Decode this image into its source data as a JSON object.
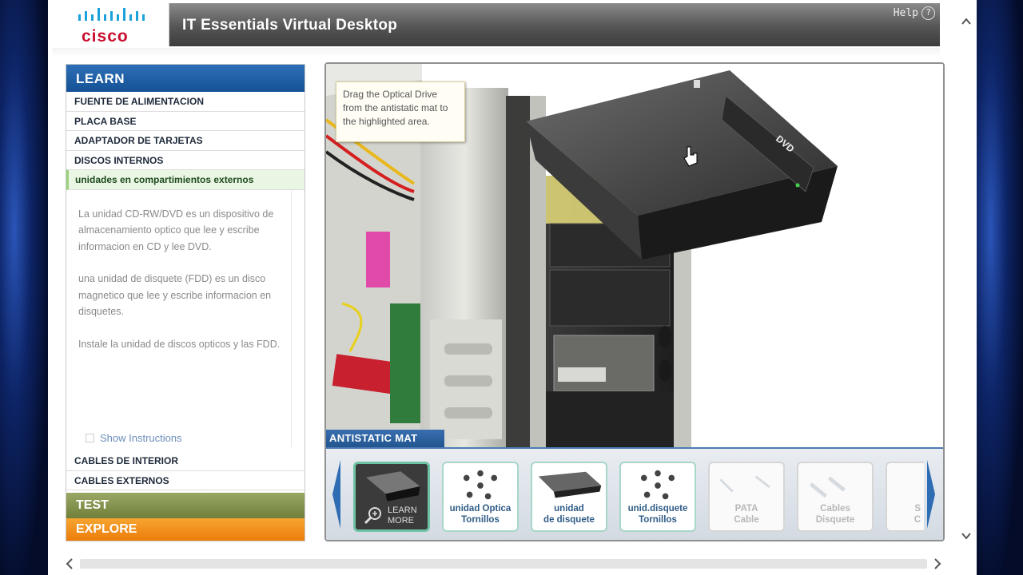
{
  "header": {
    "brand": "cisco",
    "title": "IT Essentials Virtual Desktop",
    "help_label": "Help",
    "help_icon_glyph": "?"
  },
  "learn": {
    "heading": "LEARN",
    "items": [
      {
        "label": "FUENTE DE ALIMENTACION"
      },
      {
        "label": "PLACA BASE"
      },
      {
        "label": "ADAPTADOR DE TARJETAS"
      },
      {
        "label": "DISCOS INTERNOS"
      },
      {
        "label": "unidades en compartimientos externos",
        "active": true
      }
    ],
    "description": [
      "La unidad CD-RW/DVD es un dispositivo de almacenamiento optico que lee y escribe informacion en CD y lee DVD.",
      "una unidad de disquete (FDD) es un disco magnetico que lee y escribe informacion en disquetes.",
      "Instale la unidad de discos opticos y las FDD."
    ],
    "show_instructions": "Show Instructions",
    "more_items": [
      {
        "label": "CABLES DE INTERIOR"
      },
      {
        "label": "CABLES EXTERNOS"
      }
    ]
  },
  "tabs": {
    "test": "TEST",
    "explore": "EXPLORE"
  },
  "scene": {
    "tooltip": "Drag the Optical Drive from the antistatic mat to the highlighted area.",
    "drive_label": "DVD",
    "mat_label": "ANTISTATIC MAT"
  },
  "tray": {
    "cards": [
      {
        "line1": "LEARN",
        "line2": "MORE",
        "state": "selected",
        "icon": "optical-drive-icon"
      },
      {
        "line1": "unidad Optica",
        "line2": "Tornillos",
        "state": "normal",
        "icon": "screws-icon"
      },
      {
        "line1": "unidad",
        "line2": "de disquete",
        "state": "normal",
        "icon": "floppy-drive-icon"
      },
      {
        "line1": "unid.disquete",
        "line2": "Tornillos",
        "state": "normal",
        "icon": "screws-icon"
      },
      {
        "line1": "PATA",
        "line2": "Cable",
        "state": "disabled",
        "icon": "pata-cable-icon"
      },
      {
        "line1": "Cables",
        "line2": "Disquete",
        "state": "disabled",
        "icon": "floppy-cable-icon"
      },
      {
        "line1": "S",
        "line2": "C",
        "state": "disabled",
        "icon": "cable-icon"
      }
    ]
  },
  "colors": {
    "learn_blue": "#1b5ea6",
    "test_green": "#7f8f44",
    "explore_orange": "#f08a12",
    "header_gray": "#4a4a4a",
    "cisco_red": "#c8102e"
  }
}
